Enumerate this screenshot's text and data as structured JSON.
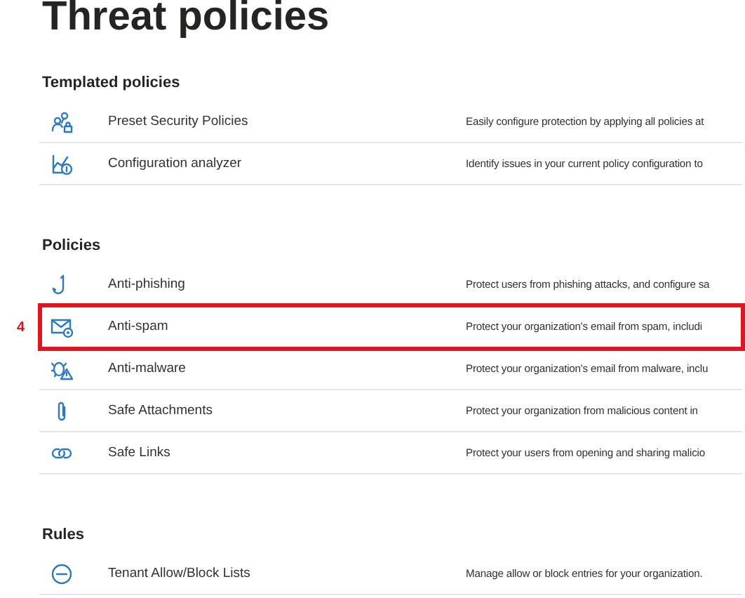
{
  "title": "Threat policies",
  "sections": [
    {
      "heading": "Templated policies",
      "items": [
        {
          "kind": "people-lock",
          "name": "Preset Security Policies",
          "description": "Easily configure protection by applying all policies at"
        },
        {
          "kind": "chart-info",
          "name": "Configuration analyzer",
          "description": "Identify issues in your current policy configuration to"
        }
      ]
    },
    {
      "heading": "Policies",
      "items": [
        {
          "kind": "hook",
          "name": "Anti-phishing",
          "description": "Protect users from phishing attacks, and configure sa"
        },
        {
          "kind": "mail-gear",
          "name": "Anti-spam",
          "description": "Protect your organization's email from spam, includi",
          "callout": "4"
        },
        {
          "kind": "bug-warning",
          "name": "Anti-malware",
          "description": "Protect your organization's email from malware, inclu"
        },
        {
          "kind": "paperclip",
          "name": "Safe Attachments",
          "description": "Protect your organization from malicious content in"
        },
        {
          "kind": "link",
          "name": "Safe Links",
          "description": "Protect your users from opening and sharing malicio"
        }
      ]
    },
    {
      "heading": "Rules",
      "items": [
        {
          "kind": "minus-circle",
          "name": "Tenant Allow/Block Lists",
          "description": "Manage allow or block entries for your organization."
        }
      ]
    }
  ]
}
